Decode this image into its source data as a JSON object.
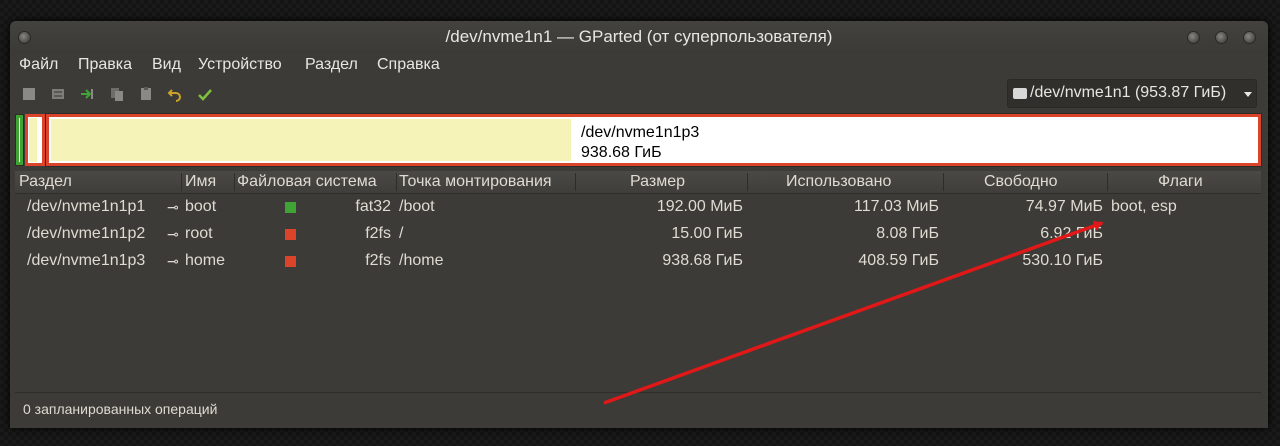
{
  "window": {
    "title": "/dev/nvme1n1 — GParted (от суперпользователя)"
  },
  "menu": [
    "Файл",
    "Правка",
    "Вид",
    "Устройство",
    "Раздел",
    "Справка"
  ],
  "device_selector": {
    "label": "/dev/nvme1n1 (953.87 ГиБ)"
  },
  "disk_map": {
    "selected_partition": "/dev/nvme1n1p3",
    "selected_size": "938.68 ГиБ"
  },
  "columns": {
    "partition": "Раздел",
    "name": "Имя",
    "filesystem": "Файловая система",
    "mountpoint": "Точка монтирования",
    "size": "Размер",
    "used": "Использовано",
    "free": "Свободно",
    "flags": "Флаги"
  },
  "partitions": [
    {
      "partition": "/dev/nvme1n1p1",
      "name": "boot",
      "fs_color": "#3fa435",
      "filesystem": "fat32",
      "mountpoint": "/boot",
      "size": "192.00 МиБ",
      "used": "117.03 МиБ",
      "free": "74.97 МиБ",
      "flags": "boot, esp"
    },
    {
      "partition": "/dev/nvme1n1p2",
      "name": "root",
      "fs_color": "#d9442b",
      "filesystem": "f2fs",
      "mountpoint": "/",
      "size": "15.00 ГиБ",
      "used": "8.08 ГиБ",
      "free": "6.92 ГиБ",
      "flags": ""
    },
    {
      "partition": "/dev/nvme1n1p3",
      "name": "home",
      "fs_color": "#d9442b",
      "filesystem": "f2fs",
      "mountpoint": "/home",
      "size": "938.68 ГиБ",
      "used": "408.59 ГиБ",
      "free": "530.10 ГиБ",
      "flags": ""
    }
  ],
  "status": {
    "text": "0 запланированных операций"
  },
  "colors": {
    "window_bg": "#3c3b37",
    "partition_border": "#d9442b",
    "used_fill": "#f5f3b8",
    "annotation_arrow": "#e01818"
  }
}
